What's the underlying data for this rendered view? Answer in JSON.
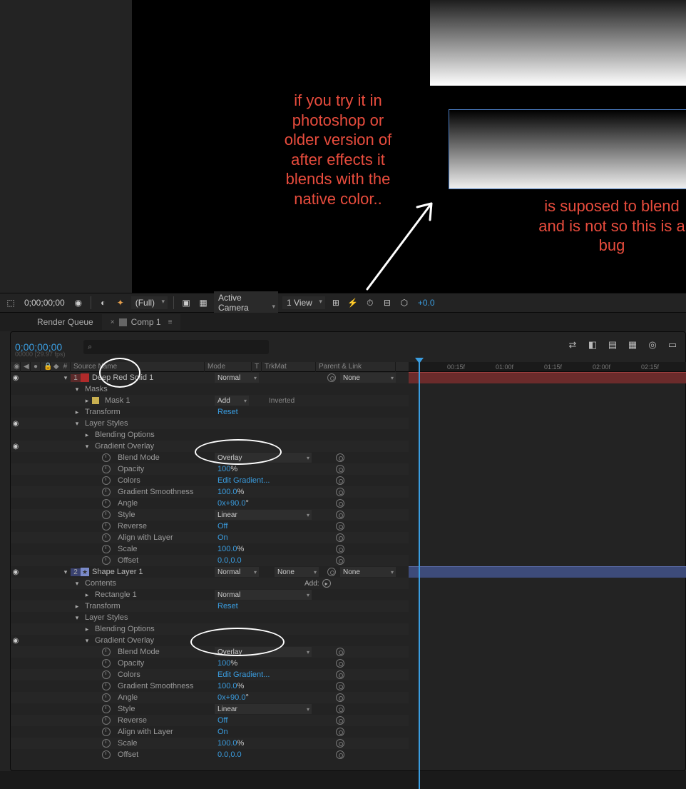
{
  "annotations": {
    "text1": "if you try it in photoshop or older version of after effects it blends with the native color..",
    "text2": "is suposed to blend and is not so this is a bug"
  },
  "toolbar": {
    "timecode": "0;00;00;00",
    "resolution": "(Full)",
    "camera": "Active Camera",
    "views": "1 View",
    "exposure": "+0.0"
  },
  "tabs": {
    "render_queue": "Render Queue",
    "comp": "Comp 1"
  },
  "timeline": {
    "timecode": "0;00;00;00",
    "fps": "00000 (29.97 fps)",
    "search_placeholder": "⌕",
    "columns": {
      "source": "Source Name",
      "mode": "Mode",
      "t": "T",
      "trkmat": "TrkMat",
      "parent": "Parent & Link"
    },
    "ruler": [
      "00:15f",
      "01:00f",
      "01:15f",
      "02:00f",
      "02:15f"
    ]
  },
  "layers": {
    "l1": {
      "num": "1",
      "name": "Deep Red Solid 1",
      "mode": "Normal",
      "parent": "None",
      "masks": "Masks",
      "mask1": "Mask 1",
      "mask_mode": "Add",
      "inverted": "Inverted",
      "transform": "Transform",
      "reset": "Reset",
      "layer_styles": "Layer Styles",
      "blending_options": "Blending Options",
      "gradient_overlay": "Gradient Overlay",
      "props": {
        "blend_mode": {
          "label": "Blend Mode",
          "value": "Overlay"
        },
        "opacity": {
          "label": "Opacity",
          "value": "100",
          "suffix": "%"
        },
        "colors": {
          "label": "Colors",
          "value": "Edit Gradient..."
        },
        "smoothness": {
          "label": "Gradient Smoothness",
          "value": "100.0",
          "suffix": "%"
        },
        "angle": {
          "label": "Angle",
          "value": "0x+90.0",
          "suffix": "°"
        },
        "style": {
          "label": "Style",
          "value": "Linear"
        },
        "reverse": {
          "label": "Reverse",
          "value": "Off"
        },
        "align": {
          "label": "Align with Layer",
          "value": "On"
        },
        "scale": {
          "label": "Scale",
          "value": "100.0",
          "suffix": "%"
        },
        "offset": {
          "label": "Offset",
          "value": "0.0,0.0"
        }
      }
    },
    "l2": {
      "num": "2",
      "name": "Shape Layer 1",
      "mode": "Normal",
      "trkmat": "None",
      "parent": "None",
      "contents": "Contents",
      "addlabel": "Add:",
      "rect": "Rectangle 1",
      "rect_mode": "Normal",
      "transform": "Transform",
      "reset": "Reset",
      "layer_styles": "Layer Styles",
      "blending_options": "Blending Options",
      "gradient_overlay": "Gradient Overlay",
      "props": {
        "blend_mode": {
          "label": "Blend Mode",
          "value": "Overlay"
        },
        "opacity": {
          "label": "Opacity",
          "value": "100",
          "suffix": "%"
        },
        "colors": {
          "label": "Colors",
          "value": "Edit Gradient..."
        },
        "smoothness": {
          "label": "Gradient Smoothness",
          "value": "100.0",
          "suffix": "%"
        },
        "angle": {
          "label": "Angle",
          "value": "0x+90.0",
          "suffix": "°"
        },
        "style": {
          "label": "Style",
          "value": "Linear"
        },
        "reverse": {
          "label": "Reverse",
          "value": "Off"
        },
        "align": {
          "label": "Align with Layer",
          "value": "On"
        },
        "scale": {
          "label": "Scale",
          "value": "100.0",
          "suffix": "%"
        },
        "offset": {
          "label": "Offset",
          "value": "0.0,0.0"
        }
      }
    }
  }
}
